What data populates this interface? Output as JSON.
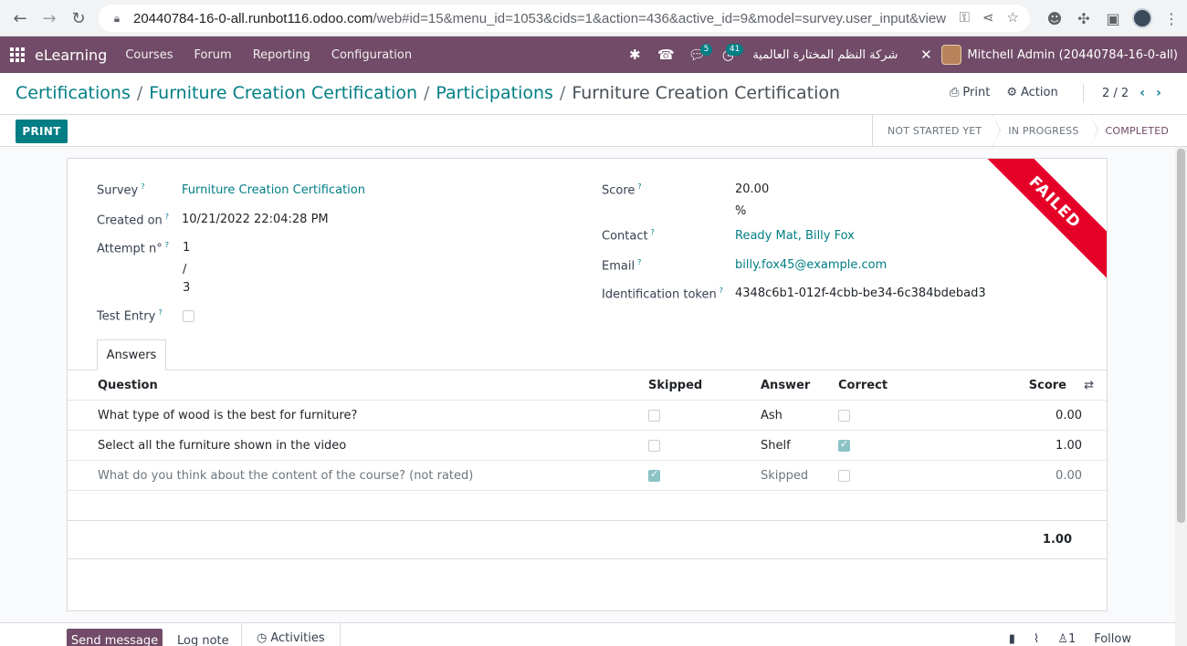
{
  "browser": {
    "url_host": "20440784-16-0-all.runbot116.odoo.com",
    "url_rest": "/web#id=15&menu_id=1053&cids=1&action=436&active_id=9&model=survey.user_input&view_t…"
  },
  "navbar": {
    "brand": "eLearning",
    "menu": [
      "Courses",
      "Forum",
      "Reporting",
      "Configuration"
    ],
    "messages_count": "5",
    "activities_count": "41",
    "company": "شركة النظم المختارة العالمية",
    "user": "Mitchell Admin (20440784-16-0-all)",
    "accent": "#714b67"
  },
  "breadcrumb": {
    "items": [
      "Certifications",
      "Furniture Creation Certification",
      "Participations"
    ],
    "current": "Furniture Creation Certification"
  },
  "toolbar": {
    "print_label": "Print",
    "action_label": "Action",
    "pager": "2 / 2",
    "print_button": "PRINT"
  },
  "status": {
    "stages": [
      "NOT STARTED YET",
      "IN PROGRESS",
      "COMPLETED"
    ],
    "active": "COMPLETED"
  },
  "form": {
    "ribbon": "FAILED",
    "survey_label": "Survey",
    "survey_value": "Furniture Creation Certification",
    "created_label": "Created on",
    "created_value": "10/21/2022 22:04:28 PM",
    "attempt_label": "Attempt n°",
    "attempt_value": "1",
    "attempt_sep": "/",
    "attempt_total": "3",
    "test_label": "Test Entry",
    "score_label": "Score",
    "score_value": "20.00",
    "score_unit": "%",
    "contact_label": "Contact",
    "contact_value": "Ready Mat, Billy Fox",
    "email_label": "Email",
    "email_value": "billy.fox45@example.com",
    "token_label": "Identification token",
    "token_value": "4348c6b1-012f-4cbb-be34-6c384bdebad3",
    "help_mark": "?"
  },
  "answers": {
    "tab_label": "Answers",
    "headers": {
      "question": "Question",
      "skipped": "Skipped",
      "answer": "Answer",
      "correct": "Correct",
      "score": "Score"
    },
    "rows": [
      {
        "question": "What type of wood is the best for furniture?",
        "skipped": false,
        "answer": "Ash",
        "correct": false,
        "score": "0.00"
      },
      {
        "question": "Select all the furniture shown in the video",
        "skipped": false,
        "answer": "Shelf",
        "correct": true,
        "score": "1.00"
      },
      {
        "question": "What do you think about the content of the course? (not rated)",
        "skipped": true,
        "answer": "Skipped",
        "correct": false,
        "score": "0.00"
      }
    ],
    "total": "1.00"
  },
  "chatter": {
    "send_message": "Send message",
    "log_note": "Log note",
    "activities": "Activities",
    "followers_count": "1",
    "follow": "Follow"
  }
}
